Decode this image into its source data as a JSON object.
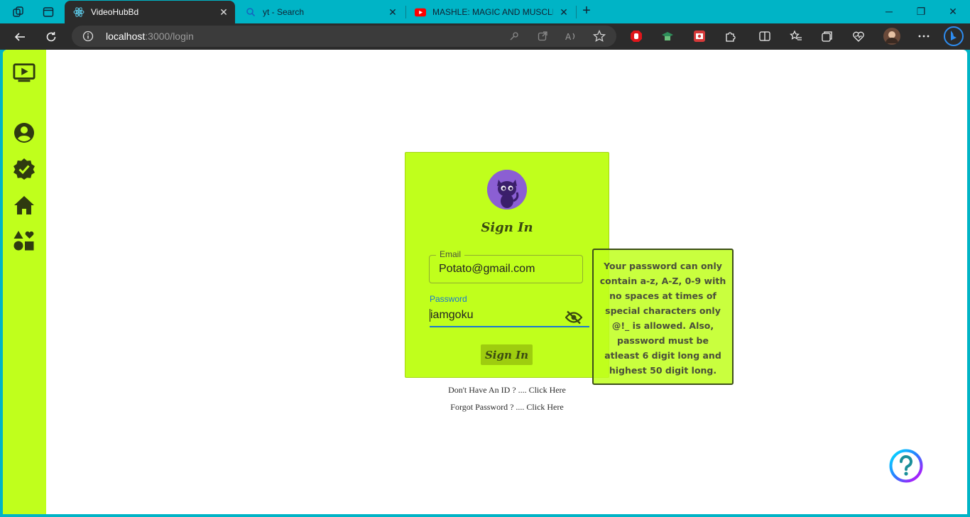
{
  "browser": {
    "tabs": [
      {
        "label": "VideoHubBd",
        "active": true
      },
      {
        "label": "yt - Search",
        "active": false
      },
      {
        "label": "MASHLE: MAGIC AND MUSCLES",
        "active": false
      }
    ],
    "address": {
      "host": "localhost",
      "path": ":3000/login"
    }
  },
  "sidebar": {
    "items": [
      {
        "icon": "video-library-icon"
      },
      {
        "icon": "account-icon"
      },
      {
        "icon": "verified-badge-icon"
      },
      {
        "icon": "home-icon"
      },
      {
        "icon": "categories-icon"
      }
    ]
  },
  "login": {
    "title": "Sign In",
    "email_label": "Email",
    "email_value": "Potato@gmail.com",
    "password_label": "Password",
    "password_value": "iamgoku",
    "submit_label": "Sign In",
    "register_link": "Don't Have An ID ? .... Click Here",
    "forgot_link": "Forgot Password ? .... Click Here"
  },
  "tooltip": {
    "text": "Your password can only contain a-z, A-Z, 0-9 with no spaces at times of special characters only @!_ is allowed. Also, password must be atleast 6 digit long and highest 50 digit long."
  },
  "colors": {
    "accent": "#c0ff1c",
    "browser_frame": "#00b4c6",
    "focus_blue": "#1976d2"
  }
}
